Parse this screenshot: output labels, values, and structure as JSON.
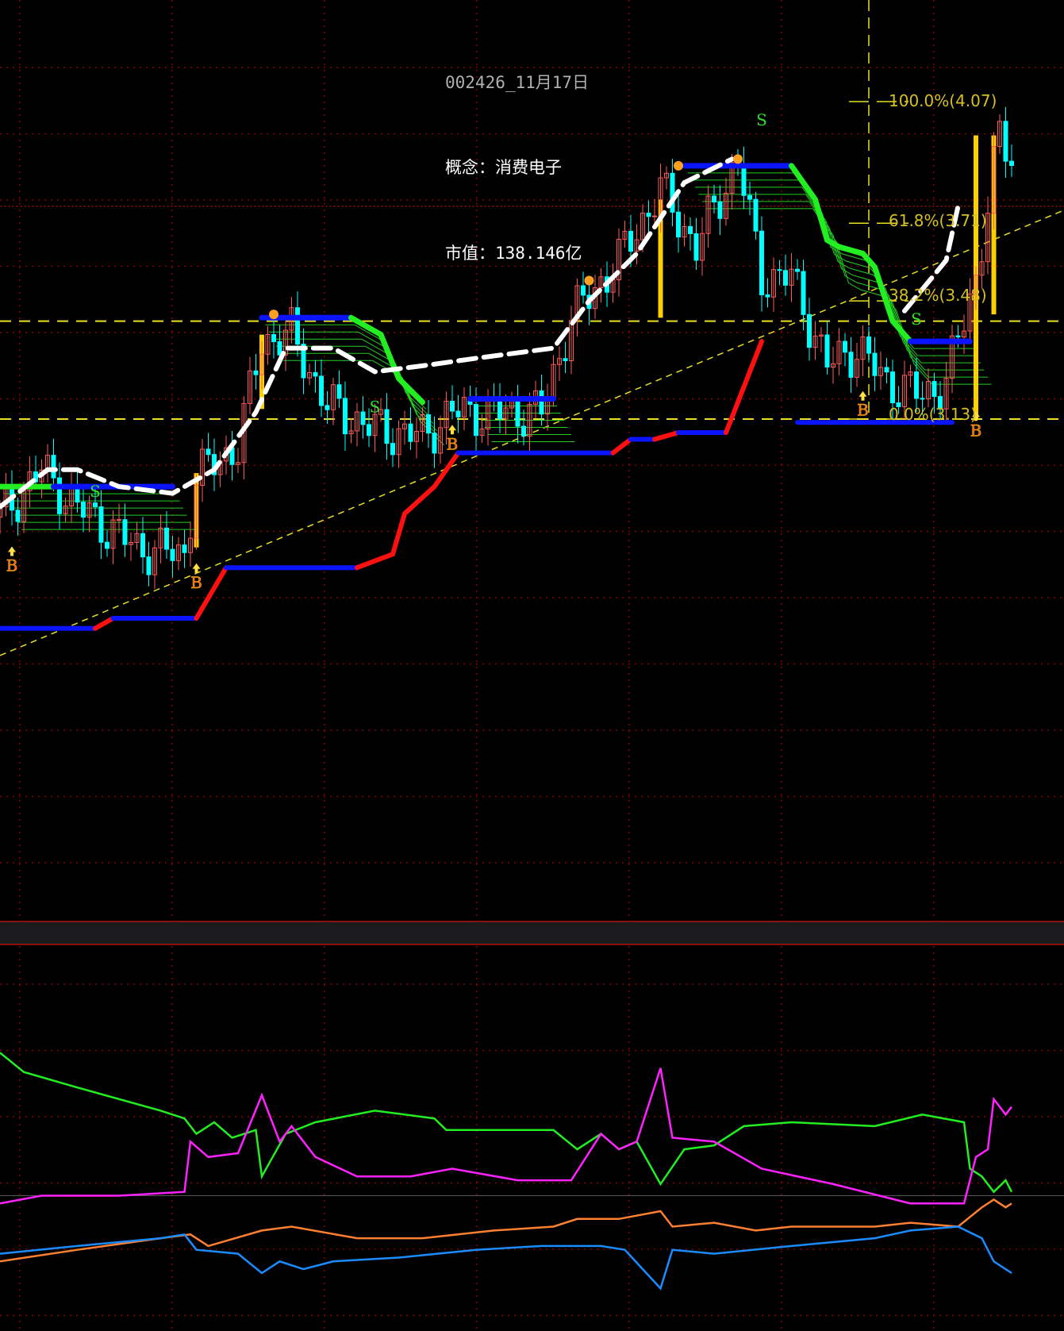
{
  "header": {
    "code_date": "002426_11月17日",
    "concept": "概念：消费电子",
    "market_cap": "市值：138.146亿"
  },
  "colors": {
    "up": "#ff5a5a",
    "down": "#00ffff",
    "support_blue": "#0a14ff",
    "support_red": "#ff1010",
    "resist_green": "#22ee22",
    "ma_white": "#ffffff",
    "fib": "#d4c020",
    "grid": "#8b0000"
  },
  "chart_data": [
    {
      "type": "candlestick",
      "title": "002426_11月17日",
      "x_unit": "bar",
      "xlim": [
        0,
        179
      ],
      "ylim": [
        1.67,
        4.37
      ],
      "grid": true,
      "price_keypoints": [
        [
          0,
          2.84
        ],
        [
          7,
          2.98
        ],
        [
          13,
          2.87
        ],
        [
          23,
          2.75
        ],
        [
          31,
          2.73
        ],
        [
          33,
          2.96
        ],
        [
          40,
          3.05
        ],
        [
          44,
          3.36
        ],
        [
          49,
          3.38
        ],
        [
          55,
          3.17
        ],
        [
          63,
          3.1
        ],
        [
          71,
          3.08
        ],
        [
          76,
          3.15
        ],
        [
          83,
          3.15
        ],
        [
          91,
          3.15
        ],
        [
          96,
          3.43
        ],
        [
          104,
          3.6
        ],
        [
          111,
          3.81
        ],
        [
          117,
          3.64
        ],
        [
          124,
          3.9
        ],
        [
          128,
          3.55
        ],
        [
          133,
          3.55
        ],
        [
          139,
          3.29
        ],
        [
          144,
          3.34
        ],
        [
          149,
          3.24
        ],
        [
          155,
          3.2
        ],
        [
          159,
          3.24
        ],
        [
          164,
          3.55
        ],
        [
          168,
          3.97
        ],
        [
          170,
          3.9
        ]
      ],
      "support_segments": [
        {
          "color": "blue",
          "pts": [
            [
              0,
              2.51
            ],
            [
              16,
              2.51
            ]
          ]
        },
        {
          "color": "red",
          "pts": [
            [
              16,
              2.51
            ],
            [
              19,
              2.54
            ]
          ]
        },
        {
          "color": "blue",
          "pts": [
            [
              19,
              2.54
            ],
            [
              33,
              2.54
            ]
          ]
        },
        {
          "color": "red",
          "pts": [
            [
              33,
              2.54
            ],
            [
              35,
              2.6
            ],
            [
              38,
              2.69
            ]
          ]
        },
        {
          "color": "blue",
          "pts": [
            [
              38,
              2.69
            ],
            [
              60,
              2.69
            ]
          ]
        },
        {
          "color": "red",
          "pts": [
            [
              60,
              2.69
            ],
            [
              66,
              2.73
            ],
            [
              68,
              2.85
            ],
            [
              73,
              2.93
            ],
            [
              77,
              3.03
            ]
          ]
        },
        {
          "color": "blue",
          "pts": [
            [
              77,
              3.03
            ],
            [
              103,
              3.03
            ]
          ]
        },
        {
          "color": "red",
          "pts": [
            [
              103,
              3.03
            ],
            [
              106,
              3.07
            ]
          ]
        },
        {
          "color": "blue",
          "pts": [
            [
              106,
              3.07
            ],
            [
              110,
              3.07
            ]
          ]
        },
        {
          "color": "red",
          "pts": [
            [
              110,
              3.07
            ],
            [
              114,
              3.09
            ]
          ]
        },
        {
          "color": "blue",
          "pts": [
            [
              114,
              3.09
            ],
            [
              122,
              3.09
            ]
          ]
        },
        {
          "color": "red",
          "pts": [
            [
              122,
              3.09
            ],
            [
              126,
              3.27
            ],
            [
              128,
              3.36
            ]
          ]
        },
        {
          "color": "blue",
          "pts": [
            [
              134,
              3.12
            ],
            [
              160,
              3.12
            ]
          ]
        }
      ],
      "resistance_segments": [
        {
          "color": "green",
          "pts": [
            [
              0,
              2.93
            ],
            [
              9,
              2.93
            ]
          ]
        },
        {
          "color": "blue",
          "pts": [
            [
              9,
              2.93
            ],
            [
              29,
              2.93
            ]
          ]
        },
        {
          "color": "blue",
          "pts": [
            [
              44,
              3.43
            ],
            [
              59,
              3.43
            ]
          ]
        },
        {
          "color": "green",
          "pts": [
            [
              59,
              3.43
            ],
            [
              64,
              3.38
            ],
            [
              67,
              3.25
            ],
            [
              71,
              3.18
            ]
          ]
        },
        {
          "color": "blue",
          "pts": [
            [
              79,
              3.19
            ],
            [
              93,
              3.19
            ]
          ]
        },
        {
          "color": "blue",
          "pts": [
            [
              115,
              3.88
            ],
            [
              133,
              3.88
            ]
          ]
        },
        {
          "color": "green",
          "pts": [
            [
              133,
              3.88
            ],
            [
              137,
              3.78
            ],
            [
              139,
              3.66
            ],
            [
              141,
              3.64
            ],
            [
              145,
              3.62
            ],
            [
              147,
              3.58
            ],
            [
              150,
              3.42
            ],
            [
              153,
              3.36
            ]
          ]
        },
        {
          "color": "blue",
          "pts": [
            [
              153,
              3.36
            ],
            [
              163,
              3.36
            ]
          ]
        }
      ],
      "ma_white": [
        [
          [
            0,
            2.87
          ],
          [
            8,
            2.98
          ],
          [
            13,
            2.98
          ],
          [
            20,
            2.93
          ],
          [
            29,
            2.91
          ],
          [
            36,
            2.98
          ],
          [
            43,
            3.15
          ],
          [
            48,
            3.34
          ],
          [
            56,
            3.34
          ],
          [
            63,
            3.27
          ],
          [
            72,
            3.29
          ],
          [
            80,
            3.31
          ],
          [
            93,
            3.34
          ],
          [
            99,
            3.48
          ],
          [
            107,
            3.62
          ],
          [
            115,
            3.83
          ],
          [
            123,
            3.9
          ]
        ],
        [
          [
            152,
            3.45
          ],
          [
            159,
            3.6
          ],
          [
            161,
            3.76
          ]
        ]
      ],
      "trend_line": [
        [
          0,
          2.43
        ],
        [
          179,
          3.75
        ]
      ],
      "horizontal_levels": [
        3.42,
        3.13
      ],
      "current_price_line": 3.76,
      "fibonacci": {
        "anchor_bar": 146,
        "levels": [
          {
            "label": "100.0%(4.07)",
            "price": 4.07
          },
          {
            "label": "61.8%(3.71)",
            "price": 3.71
          },
          {
            "label": "38.2%(3.48)",
            "price": 3.48
          },
          {
            "label": "0.0%(3.13)",
            "price": 3.13
          }
        ]
      },
      "signals": [
        {
          "type": "B",
          "bar": 2,
          "price": 2.68
        },
        {
          "type": "B",
          "bar": 33,
          "price": 2.63
        },
        {
          "type": "B",
          "bar": 76,
          "price": 3.04
        },
        {
          "type": "B",
          "bar": 145,
          "price": 3.14
        },
        {
          "type": "B",
          "bar": 164,
          "price": 3.08
        },
        {
          "type": "S",
          "bar": 16,
          "price": 2.9
        },
        {
          "type": "S",
          "bar": 63,
          "price": 3.15
        },
        {
          "type": "S",
          "bar": 128,
          "price": 4.0
        },
        {
          "type": "S",
          "bar": 154,
          "price": 3.41
        }
      ],
      "bulb_markers": [
        [
          46,
          3.44
        ],
        [
          99,
          3.54
        ],
        [
          114,
          3.88
        ],
        [
          124,
          3.9
        ]
      ],
      "highlight_bars": [
        [
          33,
          2.75,
          2.97
        ],
        [
          44,
          3.16,
          3.38
        ],
        [
          111,
          3.78,
          3.43
        ],
        [
          164,
          3.13,
          3.97
        ],
        [
          167,
          3.44,
          3.97
        ]
      ]
    },
    {
      "type": "line",
      "title": "indicator",
      "x_unit": "bar",
      "ylim": [
        0,
        100
      ],
      "baseline": 35,
      "series": [
        {
          "name": "green",
          "color": "#22ee22",
          "points": [
            [
              0,
              72
            ],
            [
              4,
              67
            ],
            [
              13,
              63
            ],
            [
              27,
              57
            ],
            [
              31,
              55
            ],
            [
              33,
              51
            ],
            [
              36,
              54
            ],
            [
              39,
              50
            ],
            [
              43,
              52
            ],
            [
              44,
              40
            ],
            [
              48,
              51
            ],
            [
              53,
              54
            ],
            [
              63,
              57
            ],
            [
              73,
              55
            ],
            [
              75,
              52
            ],
            [
              83,
              52
            ],
            [
              93,
              52
            ],
            [
              97,
              47
            ],
            [
              101,
              51
            ],
            [
              104,
              47
            ],
            [
              107,
              49
            ],
            [
              111,
              38
            ],
            [
              115,
              47
            ],
            [
              120,
              48
            ],
            [
              125,
              53
            ],
            [
              133,
              54
            ],
            [
              147,
              53
            ],
            [
              155,
              56
            ],
            [
              162,
              54
            ],
            [
              163,
              42
            ],
            [
              165,
              40
            ],
            [
              167,
              36
            ],
            [
              169,
              39
            ],
            [
              170,
              36
            ]
          ]
        },
        {
          "name": "magenta",
          "color": "#ff22ff",
          "points": [
            [
              0,
              33
            ],
            [
              7,
              35
            ],
            [
              20,
              35
            ],
            [
              31,
              36
            ],
            [
              32,
              49
            ],
            [
              35,
              45
            ],
            [
              40,
              46
            ],
            [
              44,
              61
            ],
            [
              47,
              49
            ],
            [
              49,
              53
            ],
            [
              53,
              45
            ],
            [
              60,
              40
            ],
            [
              69,
              40
            ],
            [
              76,
              42
            ],
            [
              87,
              39
            ],
            [
              96,
              39
            ],
            [
              101,
              51
            ],
            [
              104,
              47
            ],
            [
              107,
              49
            ],
            [
              111,
              68
            ],
            [
              113,
              50
            ],
            [
              120,
              49
            ],
            [
              128,
              42
            ],
            [
              140,
              38
            ],
            [
              153,
              33
            ],
            [
              162,
              33
            ],
            [
              164,
              45
            ],
            [
              166,
              47
            ],
            [
              167,
              60
            ],
            [
              169,
              56
            ],
            [
              170,
              58
            ]
          ]
        },
        {
          "name": "orange",
          "color": "#ff8030",
          "points": [
            [
              0,
              18
            ],
            [
              13,
              21
            ],
            [
              27,
              24
            ],
            [
              32,
              25
            ],
            [
              35,
              22
            ],
            [
              44,
              26
            ],
            [
              49,
              27
            ],
            [
              60,
              24
            ],
            [
              71,
              24
            ],
            [
              83,
              26
            ],
            [
              93,
              27
            ],
            [
              97,
              29
            ],
            [
              104,
              29
            ],
            [
              111,
              31
            ],
            [
              113,
              27
            ],
            [
              120,
              28
            ],
            [
              127,
              26
            ],
            [
              133,
              27
            ],
            [
              147,
              27
            ],
            [
              153,
              28
            ],
            [
              161,
              27
            ],
            [
              165,
              32
            ],
            [
              167,
              34
            ],
            [
              169,
              32
            ],
            [
              170,
              33
            ]
          ]
        },
        {
          "name": "blue",
          "color": "#1a8cff",
          "points": [
            [
              0,
              20
            ],
            [
              13,
              22
            ],
            [
              27,
              24
            ],
            [
              31,
              25
            ],
            [
              33,
              21
            ],
            [
              40,
              20
            ],
            [
              44,
              15
            ],
            [
              47,
              18
            ],
            [
              51,
              16
            ],
            [
              56,
              18
            ],
            [
              67,
              19
            ],
            [
              80,
              21
            ],
            [
              91,
              22
            ],
            [
              101,
              22
            ],
            [
              105,
              21
            ],
            [
              111,
              11
            ],
            [
              113,
              21
            ],
            [
              120,
              20
            ],
            [
              133,
              22
            ],
            [
              147,
              24
            ],
            [
              153,
              26
            ],
            [
              161,
              27
            ],
            [
              165,
              24
            ],
            [
              167,
              18
            ],
            [
              170,
              15
            ]
          ]
        }
      ]
    }
  ]
}
